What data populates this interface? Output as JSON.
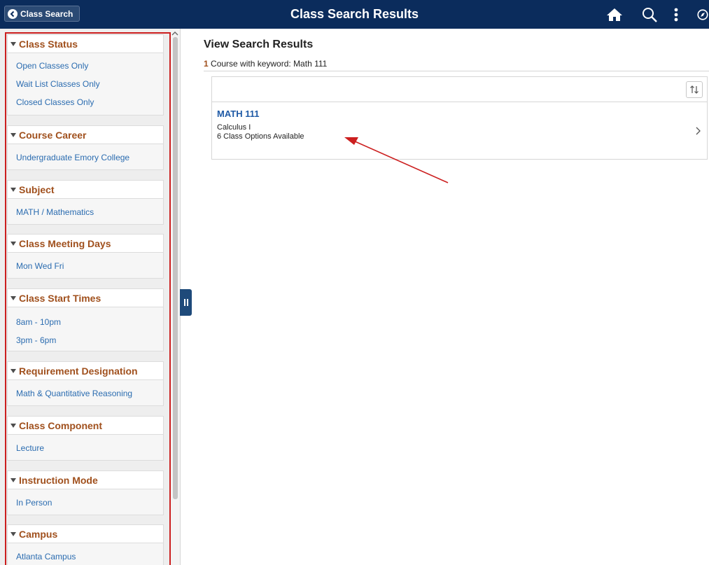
{
  "header": {
    "back_label": "Class Search",
    "title": "Class Search Results",
    "icons": [
      "home-icon",
      "search-icon",
      "more-options-icon",
      "navbar-icon"
    ]
  },
  "colors": {
    "header_bg": "#0b2c5c",
    "group_title": "#a0501d",
    "link": "#2b6cb0",
    "annotation": "#cc1f1f"
  },
  "filters": [
    {
      "title": "Class Status",
      "items": [
        "Open Classes Only",
        "Wait List Classes Only",
        "Closed Classes Only"
      ]
    },
    {
      "title": "Course Career",
      "items": [
        "Undergraduate Emory College"
      ]
    },
    {
      "title": "Subject",
      "items": [
        "MATH / Mathematics"
      ]
    },
    {
      "title": "Class Meeting Days",
      "items": [
        "Mon Wed Fri"
      ]
    },
    {
      "title": "Class Start Times",
      "items": [
        "8am - 10pm",
        "3pm - 6pm"
      ]
    },
    {
      "title": "Requirement Designation",
      "items": [
        "Math & Quantitative Reasoning"
      ]
    },
    {
      "title": "Class Component",
      "items": [
        "Lecture"
      ]
    },
    {
      "title": "Instruction Mode",
      "items": [
        "In Person"
      ]
    },
    {
      "title": "Campus",
      "items": [
        "Atlanta Campus"
      ]
    }
  ],
  "main": {
    "title": "View Search Results",
    "count": "1",
    "count_text": " Course with keyword: Math 111",
    "results": [
      {
        "code": "MATH 111",
        "name": "Calculus I",
        "options": "6 Class Options Available"
      }
    ]
  }
}
